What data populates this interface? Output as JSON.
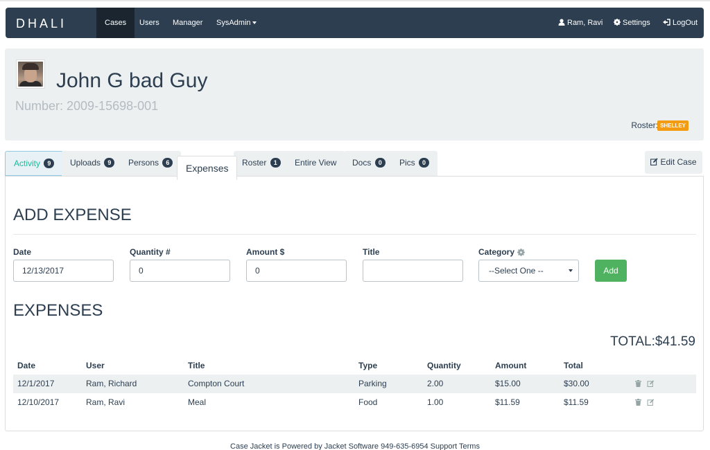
{
  "navbar": {
    "brand": "DHALI",
    "items": [
      "Cases",
      "Users",
      "Manager",
      "SysAdmin"
    ],
    "user": "Ram, Ravi",
    "settings": "Settings",
    "logout": "LogOut"
  },
  "header": {
    "name": "John G bad Guy",
    "number": "Number: 2009-15698-001",
    "roster_label": "Roster:",
    "roster_badge": "SHELLEY"
  },
  "tabs": [
    {
      "label": "Activity",
      "badge": "9"
    },
    {
      "label": "Uploads",
      "badge": "9"
    },
    {
      "label": "Persons",
      "badge": "6"
    },
    {
      "label": "Expenses",
      "badge": ""
    },
    {
      "label": "Roster",
      "badge": "1"
    },
    {
      "label": "Entire View",
      "badge": ""
    },
    {
      "label": "Docs",
      "badge": "0"
    },
    {
      "label": "Pics",
      "badge": "0"
    }
  ],
  "edit_case": "Edit Case",
  "add_expense": {
    "title": "ADD EXPENSE",
    "date_label": "Date",
    "date_value": "12/13/2017",
    "quantity_label": "Quantity #",
    "quantity_value": "0",
    "amount_label": "Amount $",
    "amount_value": "0",
    "title_label": "Title",
    "title_value": "",
    "category_label": "Category",
    "category_value": "--Select One --",
    "add_button": "Add"
  },
  "expenses": {
    "title": "EXPENSES",
    "total": "TOTAL:$41.59",
    "columns": [
      "Date",
      "User",
      "Title",
      "Type",
      "Quantity",
      "Amount",
      "Total"
    ],
    "rows": [
      [
        "12/1/2017",
        "Ram, Richard",
        "Compton Court",
        "Parking",
        "2.00",
        "$15.00",
        "$30.00"
      ],
      [
        "12/10/2017",
        "Ram, Ravi",
        "Meal",
        "Food",
        "1.00",
        "$11.59",
        "$11.59"
      ]
    ]
  },
  "footer": "Case Jacket is Powered by Jacket Software 949-635-6954 Support Terms"
}
